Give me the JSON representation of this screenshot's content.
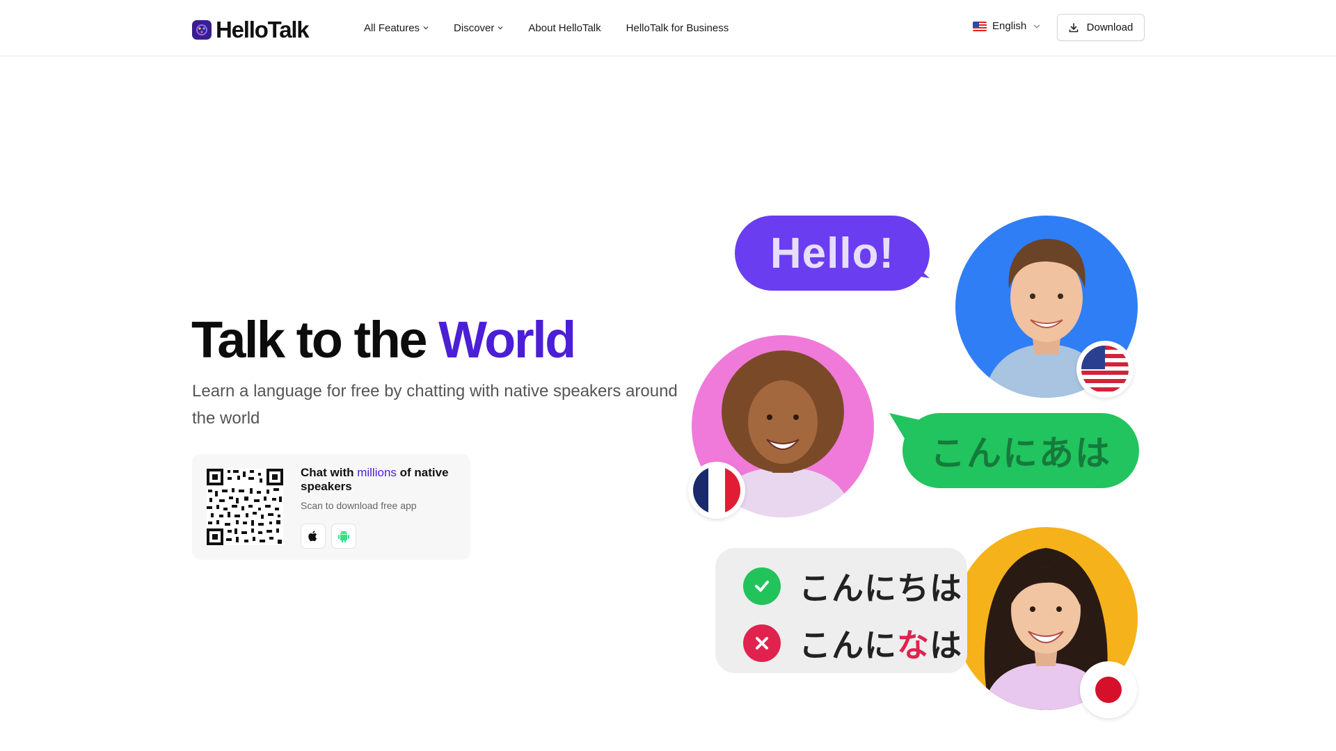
{
  "header": {
    "brand": "HelloTalk",
    "nav": [
      {
        "label": "All Features",
        "dropdown": true
      },
      {
        "label": "Discover",
        "dropdown": true
      },
      {
        "label": "About HelloTalk",
        "dropdown": false
      },
      {
        "label": "HelloTalk for Business",
        "dropdown": false
      }
    ],
    "language": "English",
    "download_label": "Download"
  },
  "hero": {
    "title_main": "Talk to the ",
    "title_accent": "World",
    "subtitle": "Learn a language for free by chatting with native speakers around the world",
    "card": {
      "title_pre": "Chat with ",
      "title_accent": "millions",
      "title_post": " of native speakers",
      "subtitle": "Scan to download free app",
      "stores": [
        "apple-icon",
        "android-icon"
      ]
    }
  },
  "illustration": {
    "bubble_hello": "Hello!",
    "bubble_japanese": "こんにあは",
    "correct_text": "こんにちは",
    "wrong_text_pre": "こんに",
    "wrong_text_err": "な",
    "wrong_text_post": "は"
  },
  "colors": {
    "accent": "#4b1fd6",
    "hello_bubble": "#6a3df0",
    "green_bubble": "#21c45e",
    "blue_circle": "#2f7ef5",
    "pink_circle": "#f07ad9",
    "yellow_circle": "#f6b21a",
    "error_red": "#e0234e"
  }
}
